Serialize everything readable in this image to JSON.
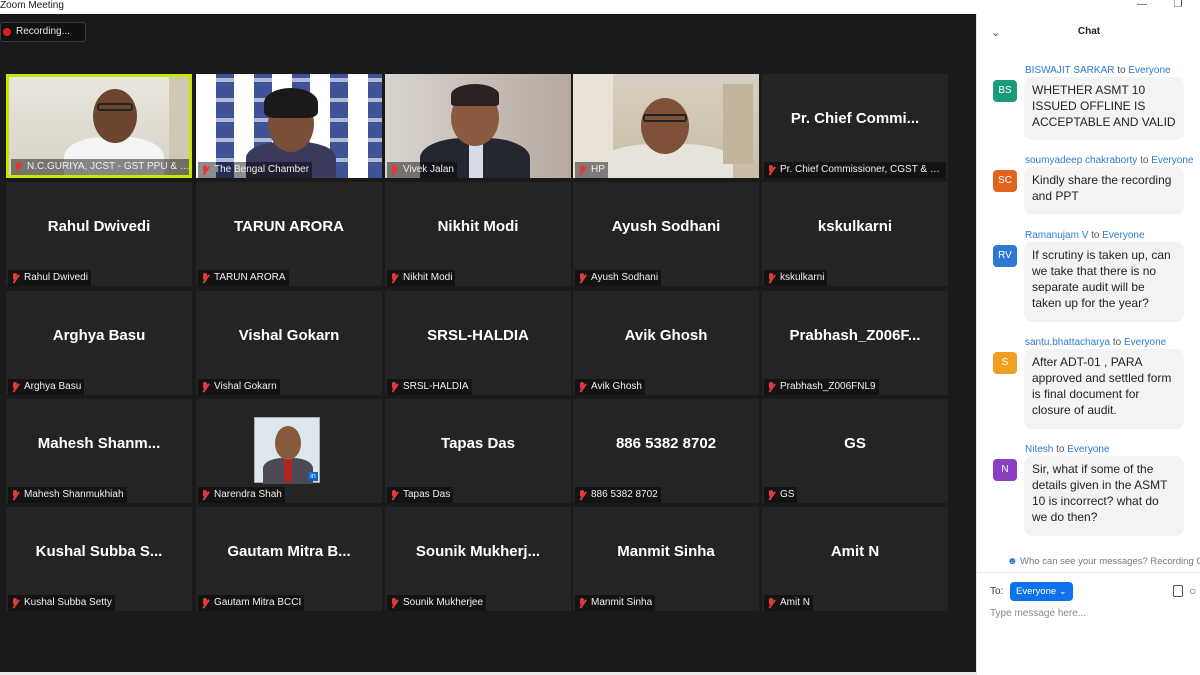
{
  "window": {
    "title": "Zoom Meeting"
  },
  "recording": {
    "label": "Recording..."
  },
  "tiles": [
    {
      "big": "",
      "label": "N.C.GURIYA, JCST - GST PPU & LTU...",
      "scene": "person1",
      "active": true
    },
    {
      "big": "",
      "label": "The Bengal Chamber",
      "scene": "bcci"
    },
    {
      "big": "",
      "label": "Vivek Jalan",
      "scene": "person3"
    },
    {
      "big": "",
      "label": "HP",
      "scene": "person4"
    },
    {
      "big": "Pr. Chief Commi...",
      "label": "Pr. Chief Commissioner, CGST & C...",
      "scene": ""
    },
    {
      "big": "Rahul Dwivedi",
      "label": "Rahul Dwivedi",
      "scene": ""
    },
    {
      "big": "TARUN ARORA",
      "label": "TARUN ARORA",
      "scene": ""
    },
    {
      "big": "Nikhit Modi",
      "label": "Nikhit Modi",
      "scene": ""
    },
    {
      "big": "Ayush Sodhani",
      "label": "Ayush Sodhani",
      "scene": ""
    },
    {
      "big": "kskulkarni",
      "label": "kskulkarni",
      "scene": ""
    },
    {
      "big": "Arghya Basu",
      "label": "Arghya Basu",
      "scene": ""
    },
    {
      "big": "Vishal Gokarn",
      "label": "Vishal Gokarn",
      "scene": ""
    },
    {
      "big": "SRSL-HALDIA",
      "label": "SRSL-HALDIA",
      "scene": ""
    },
    {
      "big": "Avik Ghosh",
      "label": "Avik Ghosh",
      "scene": ""
    },
    {
      "big": "Prabhash_Z006F...",
      "label": "Prabhash_Z006FNL9",
      "scene": ""
    },
    {
      "big": "Mahesh  Shanm...",
      "label": "Mahesh Shanmukhiah",
      "scene": ""
    },
    {
      "big": "",
      "label": "Narendra Shah",
      "scene": "photo"
    },
    {
      "big": "Tapas Das",
      "label": "Tapas Das",
      "scene": ""
    },
    {
      "big": "886 5382 8702",
      "label": "886 5382 8702",
      "scene": ""
    },
    {
      "big": "GS",
      "label": "GS",
      "scene": ""
    },
    {
      "big": "Kushal Subba S...",
      "label": "Kushal Subba Setty",
      "scene": ""
    },
    {
      "big": "Gautam  Mitra  B...",
      "label": "Gautam Mitra BCCI",
      "scene": ""
    },
    {
      "big": "Sounik  Mukherj...",
      "label": "Sounik Mukherjee",
      "scene": ""
    },
    {
      "big": "Manmit Sinha",
      "label": "Manmit Sinha",
      "scene": ""
    },
    {
      "big": "Amit N",
      "label": "Amit N",
      "scene": ""
    }
  ],
  "chat": {
    "title": "Chat",
    "messages": [
      {
        "sender": "BISWAJIT SARKAR",
        "to": "to",
        "recipient": "Everyone",
        "initials": "BS",
        "color": "#1a9c7a",
        "text": "WHETHER ASMT 10 ISSUED OFFLINE IS ACCEPTABLE  AND VALID"
      },
      {
        "sender": "soumyadeep chakraborty",
        "to": "to",
        "recipient": "Everyone",
        "initials": "SC",
        "color": "#e0641e",
        "text": "Kindly share the recording and PPT"
      },
      {
        "sender": "Ramanujam V",
        "to": "to",
        "recipient": "Everyone",
        "initials": "RV",
        "color": "#2d7ad3",
        "text": "If scrutiny is taken up, can we take that there is no separate audit will be taken up for the year?"
      },
      {
        "sender": "santu.bhattacharya",
        "to": "to",
        "recipient": "Everyone",
        "initials": "S",
        "color": "#f0a020",
        "text": "After ADT-01 , PARA approved and settled form is final document for closure of audit."
      },
      {
        "sender": "Nitesh",
        "to": "to",
        "recipient": "Everyone",
        "initials": "N",
        "color": "#8a3fc2",
        "text": "Sir, what if some of the details given in the ASMT 10 is incorrect? what do we do then?"
      }
    ],
    "privacy": "Who can see your messages? Recording C",
    "to_label": "To:",
    "to_value": "Everyone",
    "input_placeholder": "Type message here..."
  }
}
